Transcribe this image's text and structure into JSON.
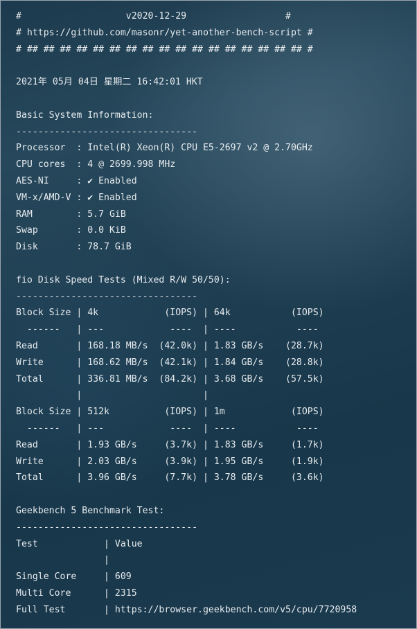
{
  "terminal": {
    "lines": [
      "#                   v2020-12-29                  #",
      "# https://github.com/masonr/yet-another-bench-script #",
      "# ## ## ## ## ## ## ## ## ## ## ## ## ## ## ## ## ## #",
      "",
      "2021年 05月 04日 星期二 16:42:01 HKT",
      "",
      "Basic System Information:",
      "---------------------------------",
      "Processor  : Intel(R) Xeon(R) CPU E5-2697 v2 @ 2.70GHz",
      "CPU cores  : 4 @ 2699.998 MHz",
      "AES-NI     : ✔ Enabled",
      "VM-x/AMD-V : ✔ Enabled",
      "RAM        : 5.7 GiB",
      "Swap       : 0.0 KiB",
      "Disk       : 78.7 GiB",
      "",
      "fio Disk Speed Tests (Mixed R/W 50/50):",
      "---------------------------------",
      "Block Size | 4k            (IOPS) | 64k           (IOPS)",
      "  ------   | ---            ----  | ----           ---- ",
      "Read       | 168.18 MB/s  (42.0k) | 1.83 GB/s    (28.7k)",
      "Write      | 168.62 MB/s  (42.1k) | 1.84 GB/s    (28.8k)",
      "Total      | 336.81 MB/s  (84.2k) | 3.68 GB/s    (57.5k)",
      "           |                      |",
      "Block Size | 512k          (IOPS) | 1m            (IOPS)",
      "  ------   | ---            ----  | ----           ---- ",
      "Read       | 1.93 GB/s     (3.7k) | 1.83 GB/s     (1.7k)",
      "Write      | 2.03 GB/s     (3.9k) | 1.95 GB/s     (1.9k)",
      "Total      | 3.96 GB/s     (7.7k) | 3.78 GB/s     (3.6k)",
      "",
      "Geekbench 5 Benchmark Test:",
      "---------------------------------",
      "Test            | Value",
      "                |",
      "Single Core     | 609",
      "Multi Core      | 2315",
      "Full Test       | https://browser.geekbench.com/v5/cpu/7720958"
    ]
  }
}
